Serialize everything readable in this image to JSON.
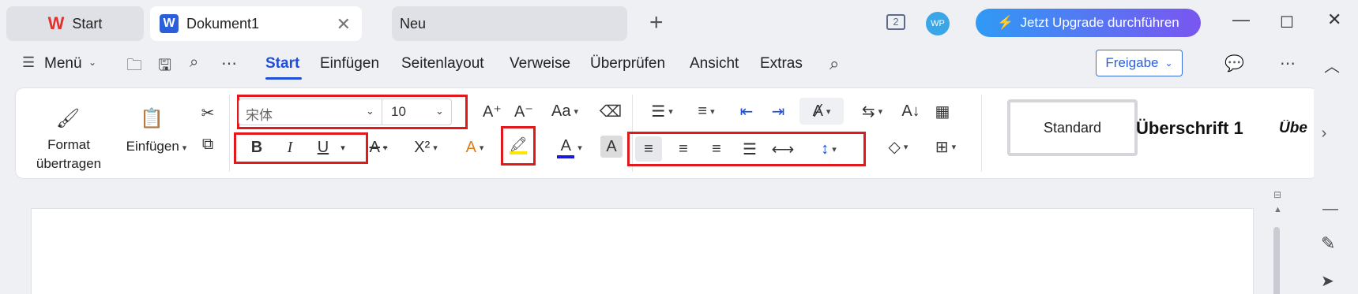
{
  "tabs": {
    "start_label": "Start",
    "doc_label": "Dokument1",
    "new_label": "Neu",
    "doc_badge": "W"
  },
  "titlebar": {
    "window_count": "2",
    "avatar": "WP",
    "upgrade_label": "Jetzt Upgrade durchführen"
  },
  "menu": {
    "menu_label": "Menü",
    "tabs": [
      "Start",
      "Einfügen",
      "Seitenlayout",
      "Verweise",
      "Überprüfen",
      "Ansicht",
      "Extras"
    ],
    "share_label": "Freigabe"
  },
  "ribbon": {
    "format_label_1": "Format",
    "format_label_2": "übertragen",
    "paste_label": "Einfügen",
    "font_name": "宋体",
    "font_size": "10",
    "bold": "B",
    "italic": "I",
    "underline": "U",
    "superscript": "X²",
    "styles": [
      "Standard",
      "Überschrift 1",
      "Übe"
    ]
  },
  "colors": {
    "accent": "#1f4ed8",
    "highlight_red": "#e0191d",
    "highlight_yellow": "#ffe600",
    "font_color_blue": "#1a1ad6"
  }
}
